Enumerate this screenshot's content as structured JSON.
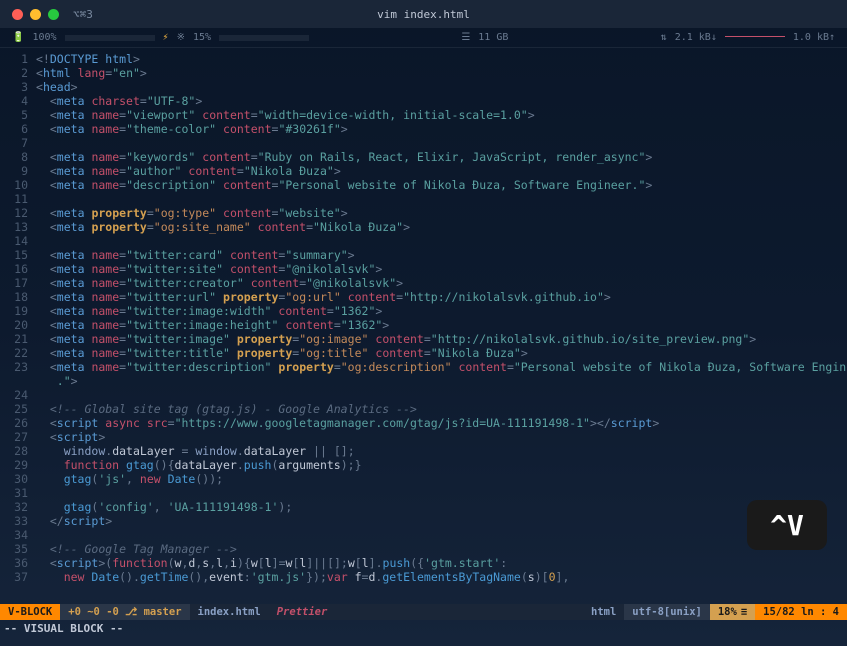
{
  "titlebar": {
    "tab": "⌥⌘3",
    "title": "vim index.html"
  },
  "stats": {
    "battery_icon": "🔋",
    "battery_pct": "100%",
    "lightning": "⚡",
    "cpu_icon": "※",
    "cpu_pct": "15%",
    "mem_icon": "☰",
    "mem": "11 GB",
    "net_down": "2.1 kB↓",
    "net_up": "1.0 kB↑"
  },
  "lines": [
    {
      "n": 1,
      "html": "<span class='pun'>&lt;!</span><span class='tag'>DOCTYPE</span> <span class='tag'>html</span><span class='pun'>&gt;</span>"
    },
    {
      "n": 2,
      "html": "<span class='pun'>&lt;</span><span class='tag'>html</span> <span class='attr'>lang</span><span class='pun'>=</span><span class='str'>\"en\"</span><span class='pun'>&gt;</span>"
    },
    {
      "n": 3,
      "html": "<span class='pun'>&lt;</span><span class='tag'>head</span><span class='pun'>&gt;</span>"
    },
    {
      "n": 4,
      "html": "  <span class='pun'>&lt;</span><span class='tag'>meta</span> <span class='attr'>charset</span><span class='pun'>=</span><span class='str'>\"UTF-8\"</span><span class='pun'>&gt;</span>"
    },
    {
      "n": 5,
      "html": "  <span class='pun'>&lt;</span><span class='tag'>meta</span> <span class='attr'>name</span><span class='pun'>=</span><span class='str'>\"viewport\"</span> <span class='attr'>content</span><span class='pun'>=</span><span class='str'>\"width=device-width, initial-scale=1.0\"</span><span class='pun'>&gt;</span>"
    },
    {
      "n": 6,
      "html": "  <span class='pun'>&lt;</span><span class='tag'>meta</span> <span class='attr'>name</span><span class='pun'>=</span><span class='str'>\"theme-color\"</span> <span class='attr'>content</span><span class='pun'>=</span><span class='str'>\"#30261f\"</span><span class='pun'>&gt;</span>"
    },
    {
      "n": 7,
      "html": " "
    },
    {
      "n": 8,
      "html": "  <span class='pun'>&lt;</span><span class='tag'>meta</span> <span class='attr'>name</span><span class='pun'>=</span><span class='str'>\"keywords\"</span> <span class='attr'>content</span><span class='pun'>=</span><span class='str'>\"Ruby on Rails, React, Elixir, JavaScript, render_async\"</span><span class='pun'>&gt;</span>"
    },
    {
      "n": 9,
      "html": "  <span class='pun'>&lt;</span><span class='tag'>meta</span> <span class='attr'>name</span><span class='pun'>=</span><span class='str'>\"author\"</span> <span class='attr'>content</span><span class='pun'>=</span><span class='str'>\"Nikola Đuza\"</span><span class='pun'>&gt;</span>"
    },
    {
      "n": 10,
      "html": "  <span class='pun'>&lt;</span><span class='tag'>meta</span> <span class='attr'>name</span><span class='pun'>=</span><span class='str'>\"description\"</span> <span class='attr'>content</span><span class='pun'>=</span><span class='str'>\"Personal website of Nikola Đuza, Software Engineer.\"</span><span class='pun'>&gt;</span>"
    },
    {
      "n": 11,
      "html": " "
    },
    {
      "n": 12,
      "html": "  <span class='pun'>&lt;</span><span class='tag'>meta</span> <span class='attr2'>property</span><span class='pun'>=</span><span class='str2'>\"og:type\"</span> <span class='attr'>content</span><span class='pun'>=</span><span class='str'>\"website\"</span><span class='pun'>&gt;</span>"
    },
    {
      "n": 13,
      "html": "  <span class='pun'>&lt;</span><span class='tag'>meta</span> <span class='attr2'>property</span><span class='pun'>=</span><span class='str2'>\"og:site_name\"</span> <span class='attr'>content</span><span class='pun'>=</span><span class='str'>\"Nikola Đuza\"</span><span class='pun'>&gt;</span>"
    },
    {
      "n": 14,
      "html": " "
    },
    {
      "n": 15,
      "html": "  <span class='pun'>&lt;</span><span class='tag'>meta</span> <span class='attr'>name</span><span class='pun'>=</span><span class='str'>\"twitter:card\"</span> <span class='attr'>content</span><span class='pun'>=</span><span class='str'>\"summary\"</span><span class='pun'>&gt;</span>"
    },
    {
      "n": 16,
      "html": "  <span class='pun'>&lt;</span><span class='tag'>meta</span> <span class='attr'>name</span><span class='pun'>=</span><span class='str'>\"twitter:site\"</span> <span class='attr'>content</span><span class='pun'>=</span><span class='str'>\"@nikolalsvk\"</span><span class='pun'>&gt;</span>"
    },
    {
      "n": 17,
      "html": "  <span class='pun'>&lt;</span><span class='tag'>meta</span> <span class='attr'>name</span><span class='pun'>=</span><span class='str'>\"twitter:creator\"</span> <span class='attr'>content</span><span class='pun'>=</span><span class='str'>\"@nikolalsvk\"</span><span class='pun'>&gt;</span>"
    },
    {
      "n": 18,
      "html": "  <span class='pun'>&lt;</span><span class='tag'>meta</span> <span class='attr'>name</span><span class='pun'>=</span><span class='str'>\"twitter:url\"</span> <span class='attr2'>property</span><span class='pun'>=</span><span class='str2'>\"og:url\"</span> <span class='attr'>content</span><span class='pun'>=</span><span class='str'>\"http://nikolalsvk.github.io\"</span><span class='pun'>&gt;</span>"
    },
    {
      "n": 19,
      "html": "  <span class='pun'>&lt;</span><span class='tag'>meta</span> <span class='attr'>name</span><span class='pun'>=</span><span class='str'>\"twitter:image:width\"</span> <span class='attr'>content</span><span class='pun'>=</span><span class='str'>\"1362\"</span><span class='pun'>&gt;</span>"
    },
    {
      "n": 20,
      "html": "  <span class='pun'>&lt;</span><span class='tag'>meta</span> <span class='attr'>name</span><span class='pun'>=</span><span class='str'>\"twitter:image:height\"</span> <span class='attr'>content</span><span class='pun'>=</span><span class='str'>\"1362\"</span><span class='pun'>&gt;</span>"
    },
    {
      "n": 21,
      "html": "  <span class='pun'>&lt;</span><span class='tag'>meta</span> <span class='attr'>name</span><span class='pun'>=</span><span class='str'>\"twitter:image\"</span> <span class='attr2'>property</span><span class='pun'>=</span><span class='str2'>\"og:image\"</span> <span class='attr'>content</span><span class='pun'>=</span><span class='str'>\"http://nikolalsvk.github.io/site_preview.png\"</span><span class='pun'>&gt;</span>"
    },
    {
      "n": 22,
      "html": "  <span class='pun'>&lt;</span><span class='tag'>meta</span> <span class='attr'>name</span><span class='pun'>=</span><span class='str'>\"twitter:title\"</span> <span class='attr2'>property</span><span class='pun'>=</span><span class='str2'>\"og:title\"</span> <span class='attr'>content</span><span class='pun'>=</span><span class='str'>\"Nikola Đuza\"</span><span class='pun'>&gt;</span>"
    },
    {
      "n": 23,
      "html": "  <span class='pun'>&lt;</span><span class='tag'>meta</span> <span class='attr'>name</span><span class='pun'>=</span><span class='str'>\"twitter:description\"</span> <span class='attr2'>property</span><span class='pun'>=</span><span class='str2'>\"og:description\"</span> <span class='attr'>content</span><span class='pun'>=</span><span class='str'>\"Personal website of Nikola Đuza, Software Engineer</span>"
    },
    {
      "n": "",
      "html": "   <span class='str'>.\"</span><span class='pun'>&gt;</span>"
    },
    {
      "n": 24,
      "html": " "
    },
    {
      "n": 25,
      "html": "  <span class='cmt'>&lt;!-- Global site tag (gtag.js) - Google Analytics --&gt;</span>"
    },
    {
      "n": 26,
      "html": "  <span class='pun'>&lt;</span><span class='tag'>script</span> <span class='attr'>async</span> <span class='attr'>src</span><span class='pun'>=</span><span class='str'>\"https://www.googletagmanager.com/gtag/js?id=UA-111191498-1\"</span><span class='pun'>&gt;&lt;/</span><span class='tag'>script</span><span class='pun'>&gt;</span>"
    },
    {
      "n": 27,
      "html": "  <span class='pun'>&lt;</span><span class='tag'>script</span><span class='pun'>&gt;</span>"
    },
    {
      "n": 28,
      "html": "    <span class='var'>window</span><span class='pun'>.</span><span class='id'>dataLayer</span> <span class='pun'>=</span> <span class='var'>window</span><span class='pun'>.</span><span class='id'>dataLayer</span> <span class='pun'>||</span> <span class='pun'>[];</span>"
    },
    {
      "n": 29,
      "html": "    <span class='kw'>function</span> <span class='fn'>gtag</span><span class='pun'>(){</span><span class='id'>dataLayer</span><span class='pun'>.</span><span class='fn'>push</span><span class='pun'>(</span><span class='id'>arguments</span><span class='pun'>);}</span>"
    },
    {
      "n": 30,
      "html": "    <span class='fn'>gtag</span><span class='pun'>(</span><span class='str'>'js'</span><span class='pun'>,</span> <span class='kw'>new</span> <span class='fn'>Date</span><span class='pun'>());</span>"
    },
    {
      "n": 31,
      "html": " "
    },
    {
      "n": 32,
      "html": "    <span class='fn'>gtag</span><span class='pun'>(</span><span class='str'>'config'</span><span class='pun'>,</span> <span class='str'>'UA-111191498-1'</span><span class='pun'>);</span>"
    },
    {
      "n": 33,
      "html": "  <span class='pun'>&lt;/</span><span class='tag'>script</span><span class='pun'>&gt;</span>"
    },
    {
      "n": 34,
      "html": " "
    },
    {
      "n": 35,
      "html": "  <span class='cmt'>&lt;!-- Google Tag Manager --&gt;</span>"
    },
    {
      "n": 36,
      "html": "  <span class='pun'>&lt;</span><span class='tag'>script</span><span class='pun'>&gt;(</span><span class='kw'>function</span><span class='pun'>(</span><span class='id'>w</span><span class='pun'>,</span><span class='id'>d</span><span class='pun'>,</span><span class='id'>s</span><span class='pun'>,</span><span class='id'>l</span><span class='pun'>,</span><span class='id'>i</span><span class='pun'>){</span><span class='id'>w</span><span class='pun'>[</span><span class='id'>l</span><span class='pun'>]=</span><span class='id'>w</span><span class='pun'>[</span><span class='id'>l</span><span class='pun'>]||[];</span><span class='id'>w</span><span class='pun'>[</span><span class='id'>l</span><span class='pun'>].</span><span class='fn'>push</span><span class='pun'>({</span><span class='str'>'gtm.start'</span><span class='pun'>:</span>"
    },
    {
      "n": 37,
      "html": "    <span class='kw'>new</span> <span class='fn'>Date</span><span class='pun'>().</span><span class='fn'>getTime</span><span class='pun'>(),</span><span class='id'>event</span><span class='pun'>:</span><span class='str'>'gtm.js'</span><span class='pun'>});</span><span class='kw'>var</span> <span class='id'>f</span><span class='pun'>=</span><span class='id'>d</span><span class='pun'>.</span><span class='fn'>getElementsByTagName</span><span class='pun'>(</span><span class='id'>s</span><span class='pun'>)[</span><span class='num'>0</span><span class='pun'>],</span>"
    }
  ],
  "statusline": {
    "mode": "V-BLOCK",
    "git": "+0 ~0 -0 ⎇ master",
    "file": "index.html",
    "formatter": "Prettier",
    "filetype": "html",
    "encoding": "utf-8[unix]",
    "percent": "18%",
    "position": "15/82 ln :  4"
  },
  "modeline": "-- VISUAL BLOCK --",
  "badge": "^V"
}
